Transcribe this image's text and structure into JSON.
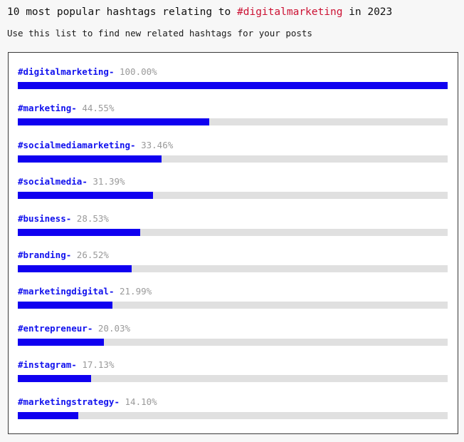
{
  "header": {
    "title_prefix": "10 most popular hashtags relating to ",
    "title_hashtag": "#digitalmarketing",
    "title_suffix": " in 2023",
    "subtitle": "Use this list to find new related hashtags for your posts"
  },
  "colors": {
    "accent_bar": "#1000f0",
    "track": "#e0e0e0",
    "hashtag_label": "#1111ee",
    "percent_text": "#9a9a9a",
    "title_highlight": "#cc1133",
    "page_background": "#f7f7f7",
    "card_background": "#ffffff",
    "card_border": "#3a3a3a"
  },
  "chart_data": {
    "type": "bar",
    "title": "10 most popular hashtags relating to #digitalmarketing in 2023",
    "subtitle": "Use this list to find new related hashtags for your posts",
    "orientation": "horizontal",
    "xlabel": "",
    "ylabel": "",
    "xlim": [
      0,
      100
    ],
    "grid": false,
    "legend": false,
    "unit": "%",
    "categories": [
      "#digitalmarketing",
      "#marketing",
      "#socialmediamarketing",
      "#socialmedia",
      "#business",
      "#branding",
      "#marketingdigital",
      "#entrepreneur",
      "#instagram",
      "#marketingstrategy"
    ],
    "values": [
      100.0,
      44.55,
      33.46,
      31.39,
      28.53,
      26.52,
      21.99,
      20.03,
      17.13,
      14.1
    ],
    "labels": [
      "100.00%",
      "44.55%",
      "33.46%",
      "31.39%",
      "28.53%",
      "26.52%",
      "21.99%",
      "20.03%",
      "17.13%",
      "14.10%"
    ]
  },
  "rows": [
    {
      "hashtag": "#digitalmarketing",
      "dash": "-",
      "pct": "100.00%",
      "value": 100.0
    },
    {
      "hashtag": "#marketing",
      "dash": "-",
      "pct": "44.55%",
      "value": 44.55
    },
    {
      "hashtag": "#socialmediamarketing",
      "dash": "-",
      "pct": "33.46%",
      "value": 33.46
    },
    {
      "hashtag": "#socialmedia",
      "dash": "-",
      "pct": "31.39%",
      "value": 31.39
    },
    {
      "hashtag": "#business",
      "dash": "-",
      "pct": "28.53%",
      "value": 28.53
    },
    {
      "hashtag": "#branding",
      "dash": "-",
      "pct": "26.52%",
      "value": 26.52
    },
    {
      "hashtag": "#marketingdigital",
      "dash": "-",
      "pct": "21.99%",
      "value": 21.99
    },
    {
      "hashtag": "#entrepreneur",
      "dash": "-",
      "pct": "20.03%",
      "value": 20.03
    },
    {
      "hashtag": "#instagram",
      "dash": "-",
      "pct": "17.13%",
      "value": 17.13
    },
    {
      "hashtag": "#marketingstrategy",
      "dash": "-",
      "pct": "14.10%",
      "value": 14.1
    }
  ]
}
